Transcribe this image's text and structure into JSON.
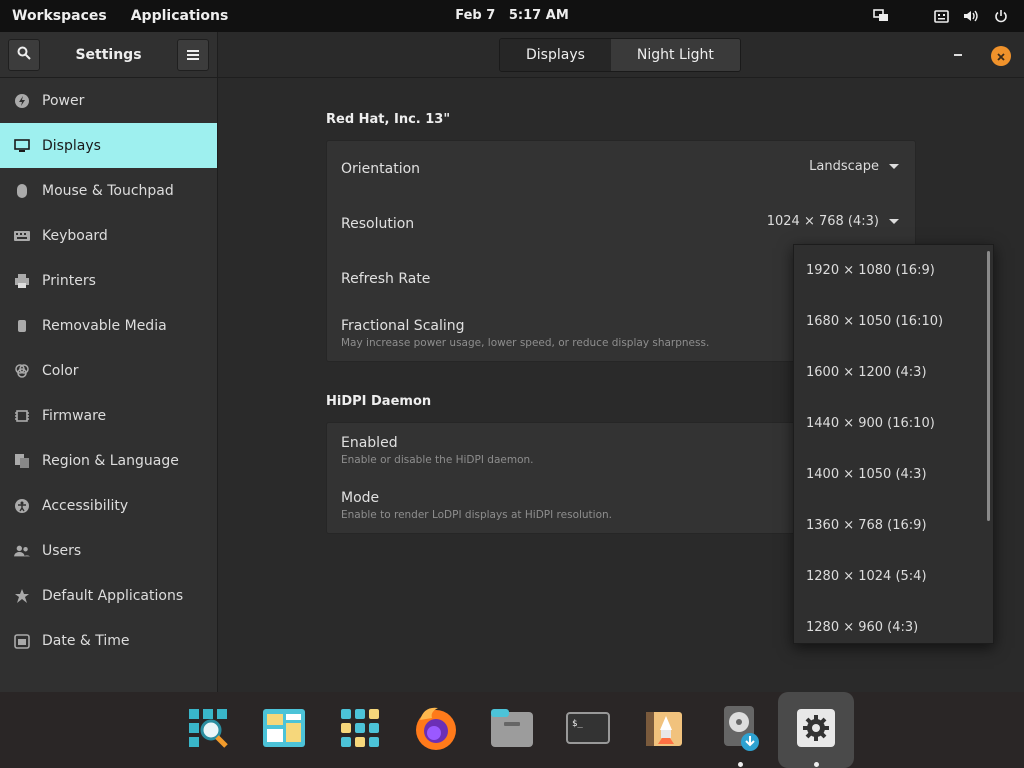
{
  "topbar": {
    "workspaces": "Workspaces",
    "applications": "Applications",
    "date": "Feb 7",
    "time": "5:17 AM",
    "icons": [
      "display-icon",
      "keyboard-icon",
      "volume-icon",
      "power-icon"
    ]
  },
  "settings": {
    "title": "Settings",
    "search_icon": "search-icon",
    "menu_icon": "hamburger-menu-icon"
  },
  "sidebar": {
    "items": [
      {
        "label": "Power",
        "icon": "power-bolt-icon"
      },
      {
        "label": "Displays",
        "icon": "display-icon",
        "active": true
      },
      {
        "label": "Mouse & Touchpad",
        "icon": "mouse-icon"
      },
      {
        "label": "Keyboard",
        "icon": "keyboard-icon"
      },
      {
        "label": "Printers",
        "icon": "printer-icon"
      },
      {
        "label": "Removable Media",
        "icon": "usb-icon"
      },
      {
        "label": "Color",
        "icon": "color-icon"
      },
      {
        "label": "Firmware",
        "icon": "chip-icon"
      },
      {
        "label": "Region & Language",
        "icon": "region-icon"
      },
      {
        "label": "Accessibility",
        "icon": "accessibility-icon"
      },
      {
        "label": "Users",
        "icon": "users-icon"
      },
      {
        "label": "Default Applications",
        "icon": "star-icon"
      },
      {
        "label": "Date & Time",
        "icon": "calendar-icon"
      }
    ]
  },
  "tabs": {
    "displays": "Displays",
    "night_light": "Night Light",
    "active": "displays"
  },
  "display": {
    "monitor_name": "Red Hat, Inc. 13\"",
    "orientation_label": "Orientation",
    "orientation_value": "Landscape",
    "resolution_label": "Resolution",
    "resolution_value": "1024 × 768 (4:3)",
    "refresh_label": "Refresh Rate",
    "scaling_label": "Fractional Scaling",
    "scaling_sub": "May increase power usage, lower speed, or reduce display sharpness."
  },
  "hidpi": {
    "title": "HiDPI Daemon",
    "enabled_label": "Enabled",
    "enabled_sub": "Enable or disable the HiDPI daemon.",
    "mode_label": "Mode",
    "mode_sub": "Enable to render LoDPI displays at HiDPI resolution."
  },
  "resolution_options": [
    "1920 × 1080 (16:9)",
    "1680 × 1050 (16:10)",
    "1600 × 1200 (4:3)",
    "1440 × 900 (16:10)",
    "1400 × 1050 (4:3)",
    "1360 × 768 (16:9)",
    "1280 × 1024 (5:4)",
    "1280 × 960 (4:3)"
  ],
  "dock": {
    "apps": [
      "search-app-icon",
      "workspaces-app-icon",
      "app-grid-icon",
      "firefox-icon",
      "files-icon",
      "terminal-icon",
      "launcher-icon",
      "installer-icon",
      "settings-gear-icon"
    ],
    "running": [
      "installer-icon",
      "settings-gear-icon"
    ]
  },
  "colors": {
    "accent": "#9ef0ef",
    "close": "#f0922b",
    "bg": "#2a2a2a"
  }
}
